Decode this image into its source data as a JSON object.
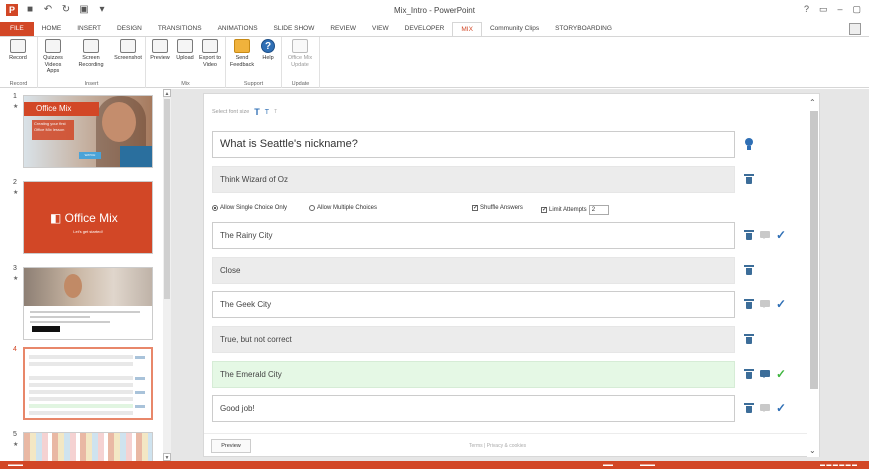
{
  "window": {
    "title": "Mix_Intro - PowerPoint",
    "controls": [
      "?",
      "▭",
      "–",
      "▢"
    ]
  },
  "qat": {
    "save_icon": "save-icon",
    "undo_icon": "undo-icon",
    "redo_icon": "redo-icon"
  },
  "tabs": [
    {
      "label": "FILE"
    },
    {
      "label": "HOME"
    },
    {
      "label": "INSERT"
    },
    {
      "label": "DESIGN"
    },
    {
      "label": "TRANSITIONS"
    },
    {
      "label": "ANIMATIONS"
    },
    {
      "label": "SLIDE SHOW"
    },
    {
      "label": "REVIEW"
    },
    {
      "label": "VIEW"
    },
    {
      "label": "DEVELOPER"
    },
    {
      "label": "MIX"
    },
    {
      "label": "Community Clips"
    },
    {
      "label": "STORYBOARDING"
    }
  ],
  "ribbon": {
    "groups": [
      {
        "label": "Record"
      },
      {
        "label": "Insert"
      },
      {
        "label": "Mix"
      },
      {
        "label": "Support"
      },
      {
        "label": "Update"
      }
    ],
    "buttons": {
      "record": "Record",
      "quizzes": "Quizzes Videos Apps",
      "screen_recording": "Screen Recording",
      "screenshot": "Screenshot",
      "preview": "Preview",
      "upload": "Upload",
      "export": "Export to Video",
      "send_feedback": "Send Feedback",
      "help": "Help",
      "update": "Office Mix Update"
    }
  },
  "slides": {
    "numbers": [
      "1",
      "2",
      "3",
      "4",
      "5"
    ],
    "slide1": {
      "title": "Office Mix",
      "subtitle": "Creating your first Office Mix lesson",
      "cta": "WATCH"
    },
    "slide2": {
      "title": "Office Mix",
      "subtitle": "Let's get started!"
    }
  },
  "editor": {
    "font_size_label": "Select font size",
    "font_icons": [
      "T",
      "T",
      "T"
    ],
    "question": "What is Seattle's nickname?",
    "question_feedback": "Think Wizard of Oz",
    "allow_single": "Allow Single Choice Only",
    "allow_multiple": "Allow Multiple Choices",
    "shuffle": "Shuffle Answers",
    "limit_attempts": "Limit Attempts",
    "attempts_value": "2",
    "answers": [
      {
        "text": "The Rainy City",
        "correct": false
      },
      {
        "text": "Close",
        "feedback": true
      },
      {
        "text": "The Geek City",
        "correct": false
      },
      {
        "text": "True, but not correct",
        "feedback": true
      },
      {
        "text": "The Emerald City",
        "correct": true
      },
      {
        "text": "Good job!",
        "feedback": true
      }
    ],
    "preview_button": "Preview",
    "footer_links": "Terms  |  Privacy & cookies"
  },
  "colors": {
    "accent": "#D24726",
    "blue": "#2F6FB5",
    "correct_green": "#3FB53F"
  }
}
